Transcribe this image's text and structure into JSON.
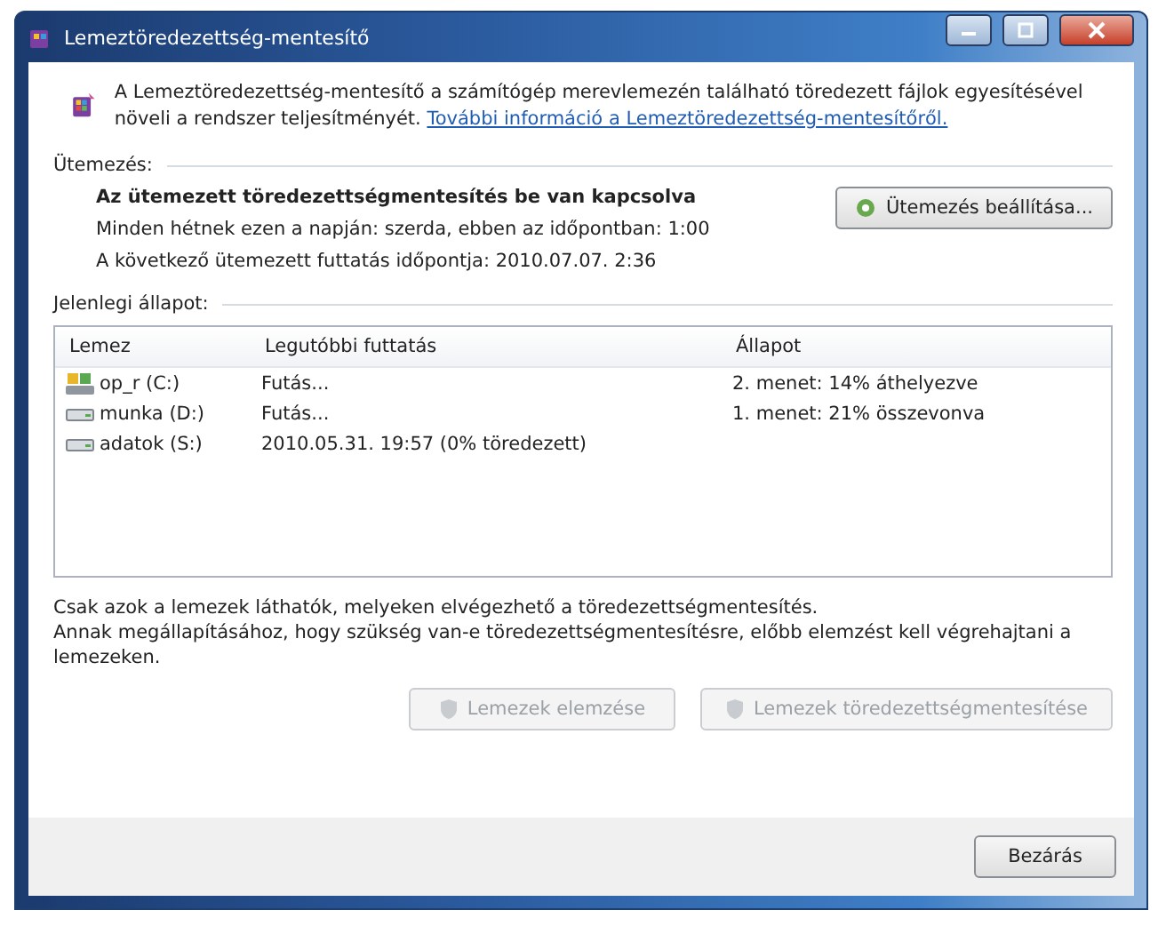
{
  "window": {
    "title": "Lemeztöredezettség-mentesítő",
    "controls": [
      {
        "kind": "minimize"
      },
      {
        "kind": "maximize"
      },
      {
        "kind": "close"
      }
    ]
  },
  "intro": {
    "text": "A Lemeztöredezettség-mentesítő a számítógép merevlemezén található töredezett fájlok egyesítésével növeli a rendszer teljesítményét.",
    "link": "További információ a Lemeztöredezettség-mentesítőről."
  },
  "schedule": {
    "heading": "Ütemezés:",
    "status": "Az ütemezett töredezettségmentesítés be van kapcsolva",
    "lines": [
      "Minden hétnek ezen a napján: szerda, ebben az időpontban: 1:00",
      "A következő ütemezett futtatás időpontja: 2010.07.07. 2:36"
    ],
    "button": {
      "label": "Ütemezés beállítása...",
      "disabled": false
    }
  },
  "current": {
    "heading": "Jelenlegi állapot:",
    "columns": [
      "Lemez",
      "Legutóbbi futtatás",
      "Állapot"
    ],
    "rows": [
      {
        "kind": "system",
        "disk": "op_r (C:)",
        "last_run": "Futás...",
        "status": "2. menet: 14% áthelyezve"
      },
      {
        "kind": "drive",
        "disk": "munka (D:)",
        "last_run": "Futás...",
        "status": "1. menet: 21% összevonva"
      },
      {
        "kind": "drive",
        "disk": "adatok (S:)",
        "last_run": "2010.05.31. 19:57 (0% töredezett)",
        "status": ""
      }
    ]
  },
  "notes": [
    "Csak azok a lemezek láthatók, melyeken elvégezhető a töredezettségmentesítés.",
    "Annak megállapításához, hogy szükség van-e töredezettségmentesítésre, előbb elemzést kell végrehajtani a lemezeken."
  ],
  "actions": [
    {
      "label": "Lemezek elemzése",
      "disabled": true
    },
    {
      "label": "Lemezek töredezettségmentesítése",
      "disabled": true
    }
  ],
  "close_button": "Bezárás"
}
